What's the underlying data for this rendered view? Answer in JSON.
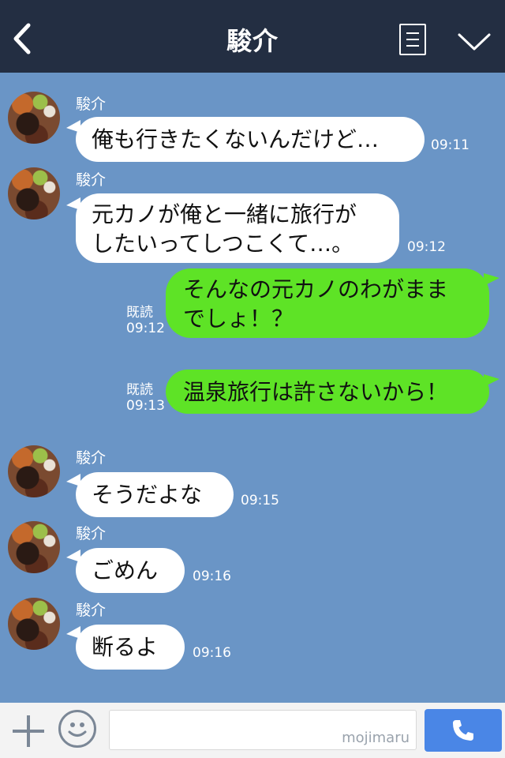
{
  "header": {
    "title": "駿介",
    "back_icon": "chevron-left-icon",
    "menu_icon": "memo-icon",
    "expand_icon": "chevron-down-icon"
  },
  "messages": [
    {
      "direction": "in",
      "sender": "駿介",
      "text": "俺も行きたくないんだけど…",
      "time": "09:11"
    },
    {
      "direction": "in",
      "sender": "駿介",
      "lines": [
        "元カノが俺と一緒に旅行が",
        "したいってしつこくて…。"
      ],
      "time": "09:12"
    },
    {
      "direction": "out",
      "read": "既読",
      "lines": [
        "そんなの元カノのわがまま",
        "でしょ！？"
      ],
      "time": "09:12"
    },
    {
      "direction": "out",
      "read": "既読",
      "text": "温泉旅行は許さないから！",
      "time": "09:13"
    },
    {
      "direction": "in",
      "sender": "駿介",
      "text": "そうだよな",
      "time": "09:15"
    },
    {
      "direction": "in",
      "sender": "駿介",
      "text": "ごめん",
      "time": "09:16"
    },
    {
      "direction": "in",
      "sender": "駿介",
      "text": "断るよ",
      "time": "09:16"
    }
  ],
  "footer": {
    "plus_icon": "plus-icon",
    "emoji_icon": "smiley-icon",
    "watermark": "mojimaru",
    "call_icon": "phone-icon"
  },
  "colors": {
    "header_bg": "#232e42",
    "chat_bg": "#6a95c6",
    "incoming_bubble": "#ffffff",
    "outgoing_bubble": "#5ee326",
    "call_button": "#4a86e6"
  }
}
